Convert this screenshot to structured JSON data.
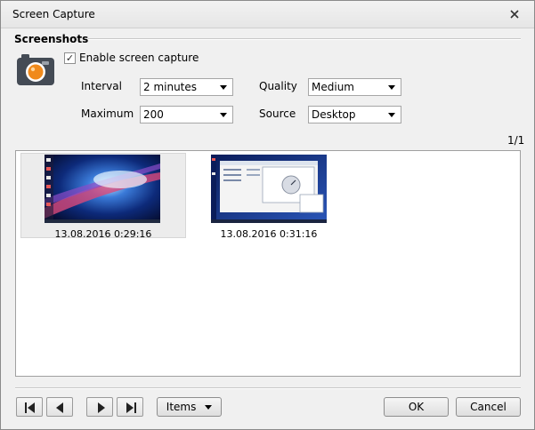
{
  "window": {
    "title": "Screen Capture"
  },
  "section": {
    "title": "Screenshots"
  },
  "enable": {
    "label": "Enable screen capture",
    "checked": true
  },
  "fields": {
    "interval": {
      "label": "Interval",
      "value": "2 minutes"
    },
    "maximum": {
      "label": "Maximum",
      "value": "200"
    },
    "quality": {
      "label": "Quality",
      "value": "Medium"
    },
    "source": {
      "label": "Source",
      "value": "Desktop"
    }
  },
  "pager": "1/1",
  "screenshots": [
    {
      "caption": "13.08.2016 0:29:16",
      "selected": true
    },
    {
      "caption": "13.08.2016 0:31:16",
      "selected": false
    }
  ],
  "buttons": {
    "items": "Items",
    "ok": "OK",
    "cancel": "Cancel"
  },
  "icons": {
    "close": "close-icon",
    "camera": "camera-icon",
    "first": "first-page-icon",
    "prev": "previous-icon",
    "next": "next-icon",
    "last": "last-page-icon",
    "dropdown": "chevron-down-icon"
  },
  "colors": {
    "camera_body": "#444b55",
    "camera_lens": "#f08a1c",
    "window_bg": "#f0f0f0"
  }
}
